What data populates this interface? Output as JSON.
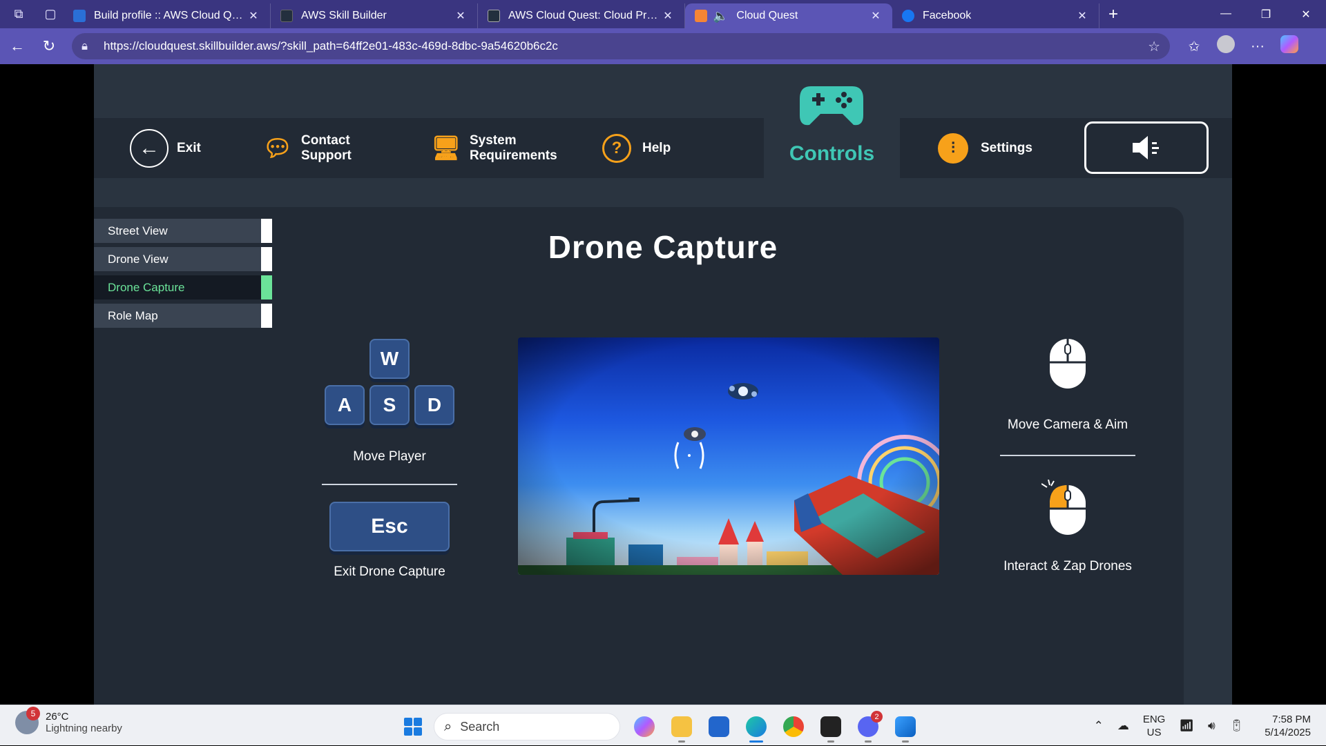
{
  "browser": {
    "tabs": [
      {
        "title": "Build profile :: AWS Cloud Quest: C",
        "favicon_color": "#2a6fd6"
      },
      {
        "title": "AWS Skill Builder",
        "favicon_color": "#232f3e"
      },
      {
        "title": "AWS Cloud Quest: Cloud Practitio",
        "favicon_color": "#232f3e"
      },
      {
        "title": "Cloud Quest",
        "favicon_color": "#f58535",
        "active": true
      },
      {
        "title": "Facebook",
        "favicon_color": "#1877f2"
      }
    ],
    "url": "https://cloudquest.skillbuilder.aws/?skill_path=64ff2e01-483c-469d-8dbc-9a54620b6c2c"
  },
  "menu": {
    "exit": "Exit",
    "contact_line1": "Contact",
    "contact_line2": "Support",
    "sysreq_line1": "System",
    "sysreq_line2": "Requirements",
    "help": "Help",
    "controls": "Controls",
    "settings": "Settings"
  },
  "sidebar": {
    "items": [
      {
        "label": "Street View"
      },
      {
        "label": "Drone View"
      },
      {
        "label": "Drone Capture",
        "active": true
      },
      {
        "label": "Role Map"
      }
    ]
  },
  "content": {
    "title": "Drone Capture",
    "keys": {
      "w": "W",
      "a": "A",
      "s": "S",
      "d": "D",
      "esc": "Esc"
    },
    "move_player": "Move Player",
    "exit_drone_capture": "Exit Drone Capture",
    "move_camera_aim": "Move Camera & Aim",
    "interact_zap": "Interact & Zap Drones"
  },
  "colors": {
    "accent_teal": "#3fc7b5",
    "accent_orange": "#f7a11a",
    "active_green": "#6be399",
    "key_blue": "#2e4f86"
  },
  "taskbar": {
    "weather_temp": "26°C",
    "weather_desc": "Lightning nearby",
    "weather_badge": "5",
    "search_placeholder": "Search",
    "discord_badge": "2",
    "lang_line1": "ENG",
    "lang_line2": "US",
    "time": "7:58 PM",
    "date": "5/14/2025"
  }
}
